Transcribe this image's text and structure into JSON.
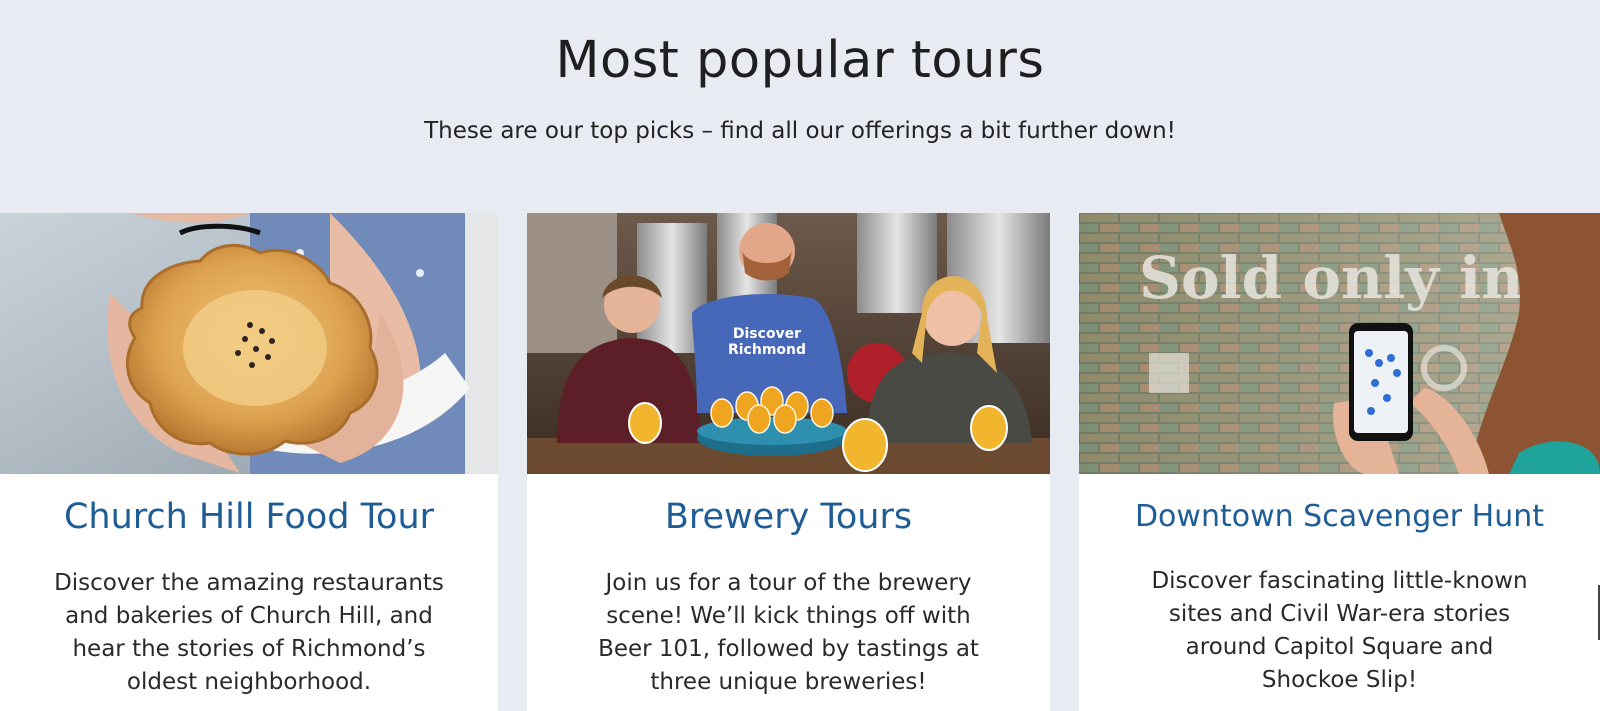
{
  "section": {
    "title": "Most popular tours",
    "subtitle": "These are our top picks – find all our offerings a bit further down!"
  },
  "cards": [
    {
      "title": "Church Hill Food Tour",
      "image_icon": "food-pie-photo",
      "description_lines": [
        "Discover the amazing restaurants",
        "and bakeries of Church Hill, and",
        "hear the  stories of Richmond’s",
        "oldest neighborhood."
      ]
    },
    {
      "title": "Brewery Tours",
      "image_icon": "brewery-tasting-photo",
      "shirt_text": [
        "Discover",
        "Richmond"
      ],
      "description_lines": [
        "Join us for a tour of the brewery",
        "scene! We’ll kick things off with",
        "Beer 101, followed by tastings at",
        "three unique breweries!"
      ]
    },
    {
      "title": "Downtown Scavenger Hunt",
      "image_icon": "scavenger-hunt-phone-photo",
      "wall_text": "Sold only in Packa",
      "description_lines": [
        "Discover fascinating little-known",
        "sites and Civil War-era stories",
        "around Capitol Square and",
        "Shockoe Slip!"
      ]
    }
  ],
  "colors": {
    "page_background": "#e8ebf2",
    "card_background": "#ffffff",
    "title_accent": "#1f5d96",
    "text": "#2a2a2a"
  }
}
